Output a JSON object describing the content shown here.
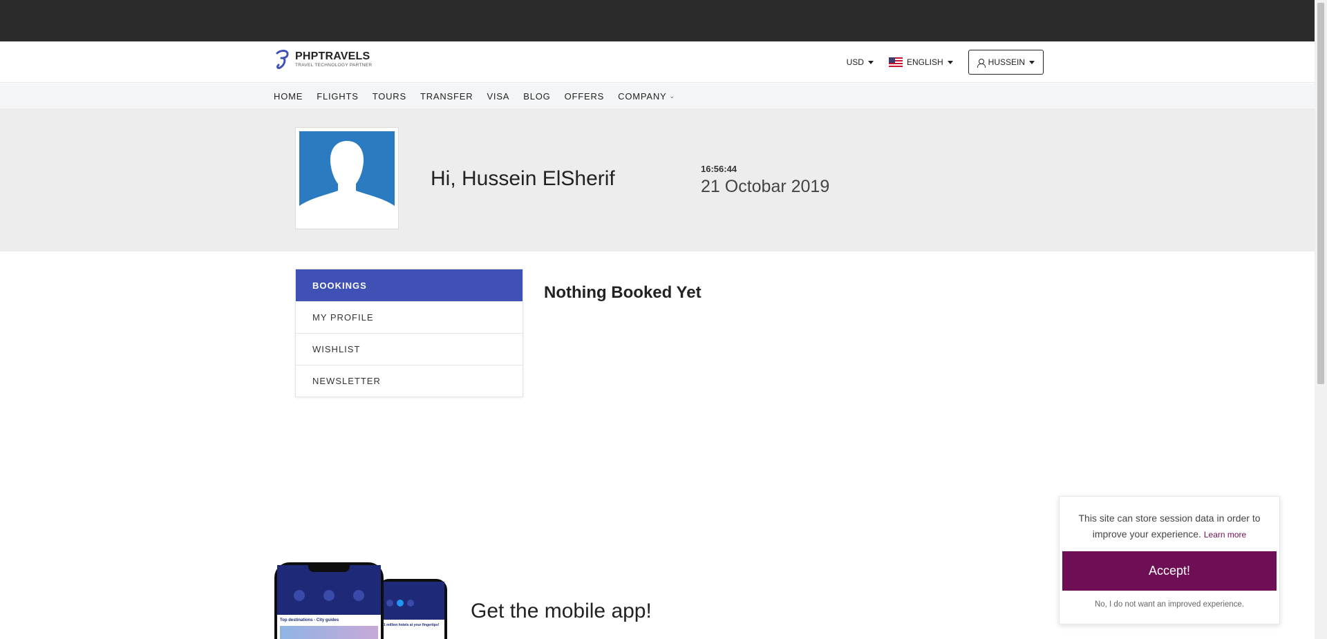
{
  "header": {
    "brand": "PHPTRAVELS",
    "tagline": "TRAVEL TECHNOLOGY PARTNER",
    "currency": "USD",
    "language": "ENGLISH",
    "user": "HUSSEIN"
  },
  "nav": {
    "items": [
      "HOME",
      "FLIGHTS",
      "TOURS",
      "TRANSFER",
      "VISA",
      "BLOG",
      "OFFERS",
      "COMPANY"
    ]
  },
  "profile": {
    "greeting": "Hi, Hussein ElSherif",
    "time": "16:56:44",
    "date": "21 Octobar 2019"
  },
  "sidebar": {
    "items": [
      {
        "label": "BOOKINGS",
        "active": true
      },
      {
        "label": "MY PROFILE",
        "active": false
      },
      {
        "label": "WISHLIST",
        "active": false
      },
      {
        "label": "NEWSLETTER",
        "active": false
      }
    ]
  },
  "main": {
    "empty_message": "Nothing Booked Yet"
  },
  "app_promo": {
    "heading": "Get the mobile app!",
    "front_screen_title": "Top destinations - City guides",
    "back_screen_title": "1 million hotels at your fingertips!"
  },
  "cookie": {
    "message": "This site can store session data in order to improve your experience.",
    "learn_more": "Learn more",
    "accept": "Accept!",
    "decline": "No, I do not want an improved experience."
  },
  "colors": {
    "accent": "#3f51b5",
    "cookie_accent": "#6e0e54",
    "topbar": "#2b2b2b"
  }
}
